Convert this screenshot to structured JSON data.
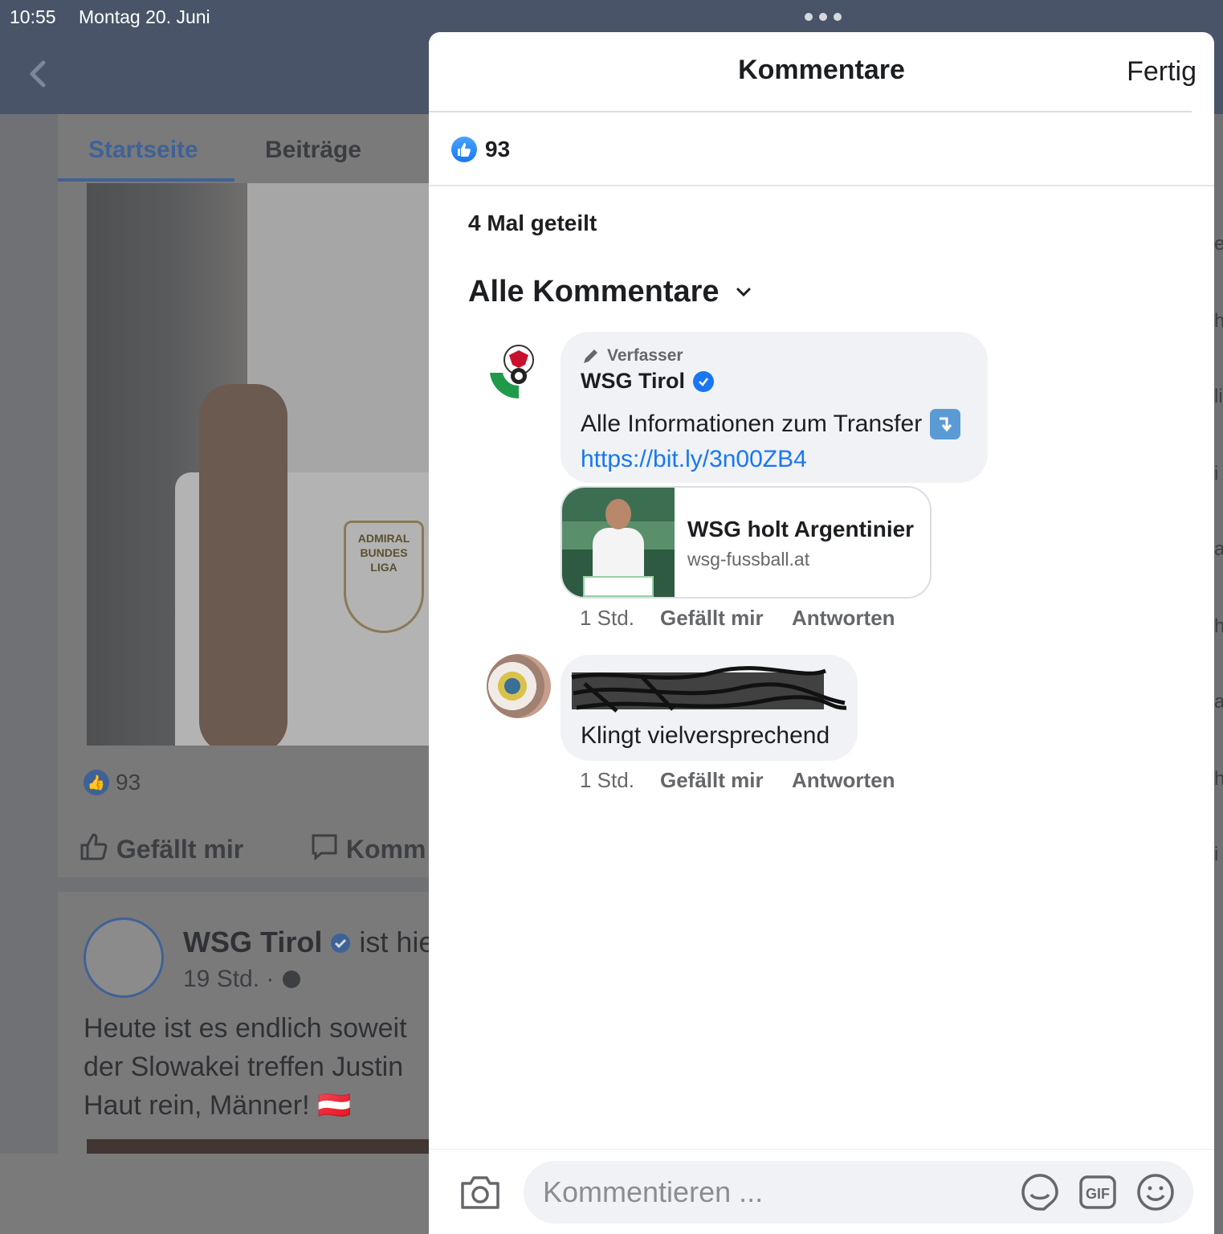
{
  "status_bar": {
    "time": "10:55",
    "date": "Montag 20. Juni"
  },
  "background": {
    "tabs": [
      "Startseite",
      "Beiträge"
    ],
    "crest_lines": [
      "ADMIRAL",
      "BUNDES",
      "LIGA"
    ],
    "like_count": "93",
    "actions": {
      "like": "Gefällt mir",
      "comment": "Komm"
    },
    "post": {
      "author": "WSG Tirol",
      "author_rest": " ist hie",
      "time": "19 Std. ·",
      "text": "Heute ist es endlich soweit\nder Slowakei treffen Justin\nHaut rein, Männer! 🇦🇹"
    }
  },
  "sheet": {
    "title": "Kommentare",
    "done_label": "Fertig",
    "like_count": "93",
    "shares": "4 Mal geteilt",
    "filter_label": "Alle Kommentare",
    "comments": [
      {
        "badge": "Verfasser",
        "author": "WSG Tirol",
        "text": "Alle Informationen zum Transfer",
        "link": "https://bit.ly/3n00ZB4",
        "preview": {
          "title": "WSG holt Argentinier",
          "domain": "wsg-fussball.at"
        },
        "time": "1 Std.",
        "like_label": "Gefällt mir",
        "reply_label": "Antworten"
      },
      {
        "text": "Klingt vielversprechend",
        "time": "1 Std.",
        "like_label": "Gefällt mir",
        "reply_label": "Antworten"
      }
    ],
    "composer": {
      "placeholder": "Kommentieren ...",
      "gif_label": "GIF"
    }
  },
  "colors": {
    "accent": "#1877f2",
    "header_bg": "#4a5468",
    "bubble_bg": "#f0f2f5"
  },
  "icons": [
    "back-chevron-icon",
    "like-icon",
    "verified-icon",
    "pencil-icon",
    "chevron-down-icon",
    "camera-icon",
    "sticker-icon",
    "gif-icon",
    "emoji-icon"
  ]
}
